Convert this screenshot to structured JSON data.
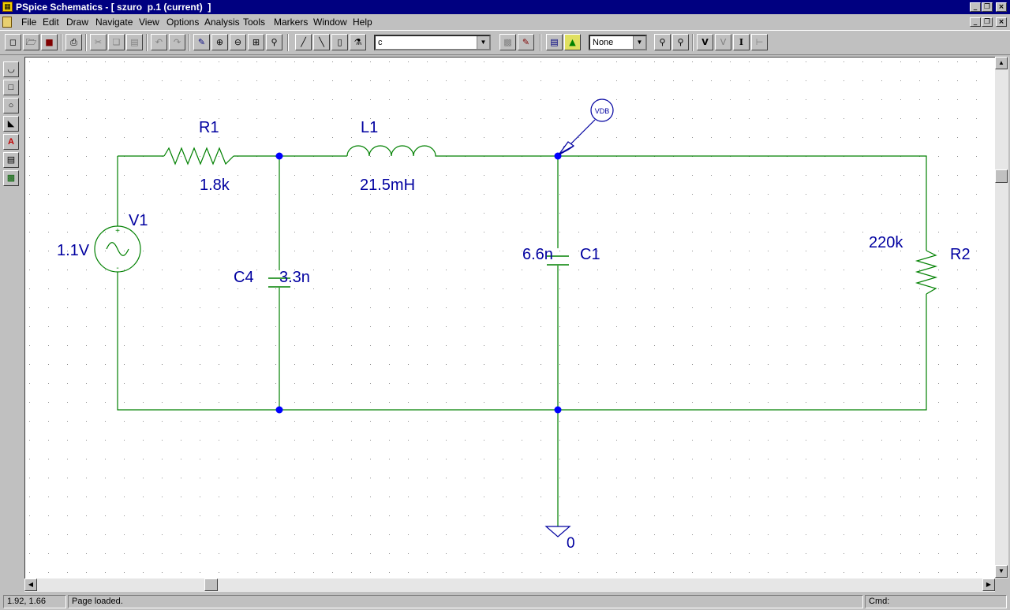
{
  "window": {
    "title": "PSpice Schematics - [ szuro  p.1 (current)  ]"
  },
  "menu": [
    "File",
    "Edit",
    "Draw",
    "Navigate",
    "View",
    "Options",
    "Analysis",
    "Tools",
    "Markers",
    "Window",
    "Help"
  ],
  "toolbar": {
    "part_combo_value": "c",
    "display_combo_value": "None",
    "buttons": [
      "new",
      "open",
      "save",
      "print",
      "cut",
      "copy",
      "paste",
      "undo",
      "redo",
      "redraw",
      "zoom-in",
      "zoom-out",
      "zoom-area",
      "zoom-fit",
      "draw-wire",
      "draw-bus",
      "draw-block",
      "get-part",
      "edit-attributes",
      "setup-analysis",
      "simulate",
      "enable-bias",
      "voltage-marker",
      "current-marker",
      "mark-advanced"
    ]
  },
  "left_tools": [
    "arc",
    "box",
    "circle",
    "polyline",
    "text",
    "text-box",
    "graphic"
  ],
  "schematic": {
    "wire_color": "#008000",
    "label_color": "#0000a0",
    "components": [
      {
        "ref": "V1",
        "value": "1.1V",
        "kind": "ac-voltage-source"
      },
      {
        "ref": "R1",
        "value": "1.8k",
        "kind": "resistor"
      },
      {
        "ref": "L1",
        "value": "21.5mH",
        "kind": "inductor"
      },
      {
        "ref": "C4",
        "value": "3.3n",
        "kind": "capacitor"
      },
      {
        "ref": "C1",
        "value": "6.6n",
        "kind": "capacitor"
      },
      {
        "ref": "R2",
        "value": "220k",
        "kind": "resistor"
      }
    ],
    "marker_label": "VDB",
    "ground_label": "0",
    "source_plus": "+",
    "source_minus": "-"
  },
  "status": {
    "coords": "1.92, 1.66",
    "message": "Page loaded.",
    "cmd_label": "Cmd:"
  }
}
